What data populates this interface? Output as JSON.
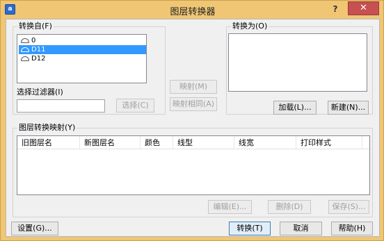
{
  "window": {
    "title": "图层转换器",
    "help": "?",
    "close": "✕",
    "icon_glyph": "a"
  },
  "convert_from": {
    "label": "转换自(F)",
    "layers": [
      {
        "name": "0",
        "selected": false
      },
      {
        "name": "D11",
        "selected": true
      },
      {
        "name": "D12",
        "selected": false
      }
    ]
  },
  "convert_to": {
    "label": "转换为(O)"
  },
  "filter": {
    "label": "选择过滤器(I)",
    "value": "",
    "select_button": "选择(C)"
  },
  "middle": {
    "map_button": "映射(M)",
    "map_same_button": "映射相同(A)"
  },
  "right_buttons": {
    "load": "加载(L)...",
    "new": "新建(N)..."
  },
  "mappings": {
    "label": "图层转换映射(Y)",
    "columns": [
      "旧图层名",
      "新图层名",
      "颜色",
      "线型",
      "线宽",
      "打印样式"
    ],
    "edit": "编辑(E)...",
    "delete": "删除(D)",
    "save": "保存(S)..."
  },
  "footer": {
    "settings": "设置(G)...",
    "convert": "转换(T)",
    "cancel": "取消",
    "help": "帮助(H)"
  },
  "colors": {
    "selection": "#3399ff",
    "close_red": "#c75050",
    "frame": "#f0c674"
  }
}
